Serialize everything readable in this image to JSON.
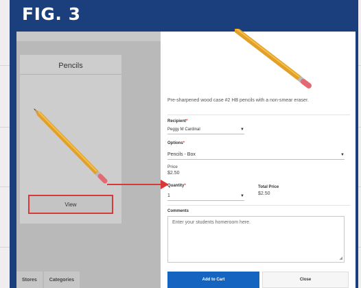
{
  "figure": {
    "title": "FIG. 3"
  },
  "left": {
    "product_name": "Pencils",
    "view_label": "View",
    "tabs": [
      "Stores",
      "Categories"
    ]
  },
  "detail": {
    "description": "Pre-sharpened wood case #2 HB pencils with a non-smear eraser.",
    "recipient": {
      "label": "Recipient",
      "required": "*",
      "value": "Peggy M Cardinal"
    },
    "options": {
      "label": "Options",
      "required": "*",
      "value": "Pencils - Box"
    },
    "price": {
      "label": "Price",
      "value": "$2.50"
    },
    "quantity": {
      "label": "Quantity",
      "required": "*",
      "value": "1"
    },
    "total": {
      "label": "Total Price",
      "value": "$2.50"
    },
    "comments": {
      "label": "Comments",
      "placeholder": "Enter your students homeroom here."
    },
    "add_to_cart_label": "Add to Cart",
    "close_label": "Close"
  },
  "colors": {
    "frame": "#1b3f7c",
    "highlight": "#d93838",
    "primary_button": "#1565c0"
  },
  "icons": {
    "product_image": "pencil-icon",
    "dropdown": "chevron-down-icon",
    "callout": "arrow-right-icon"
  }
}
